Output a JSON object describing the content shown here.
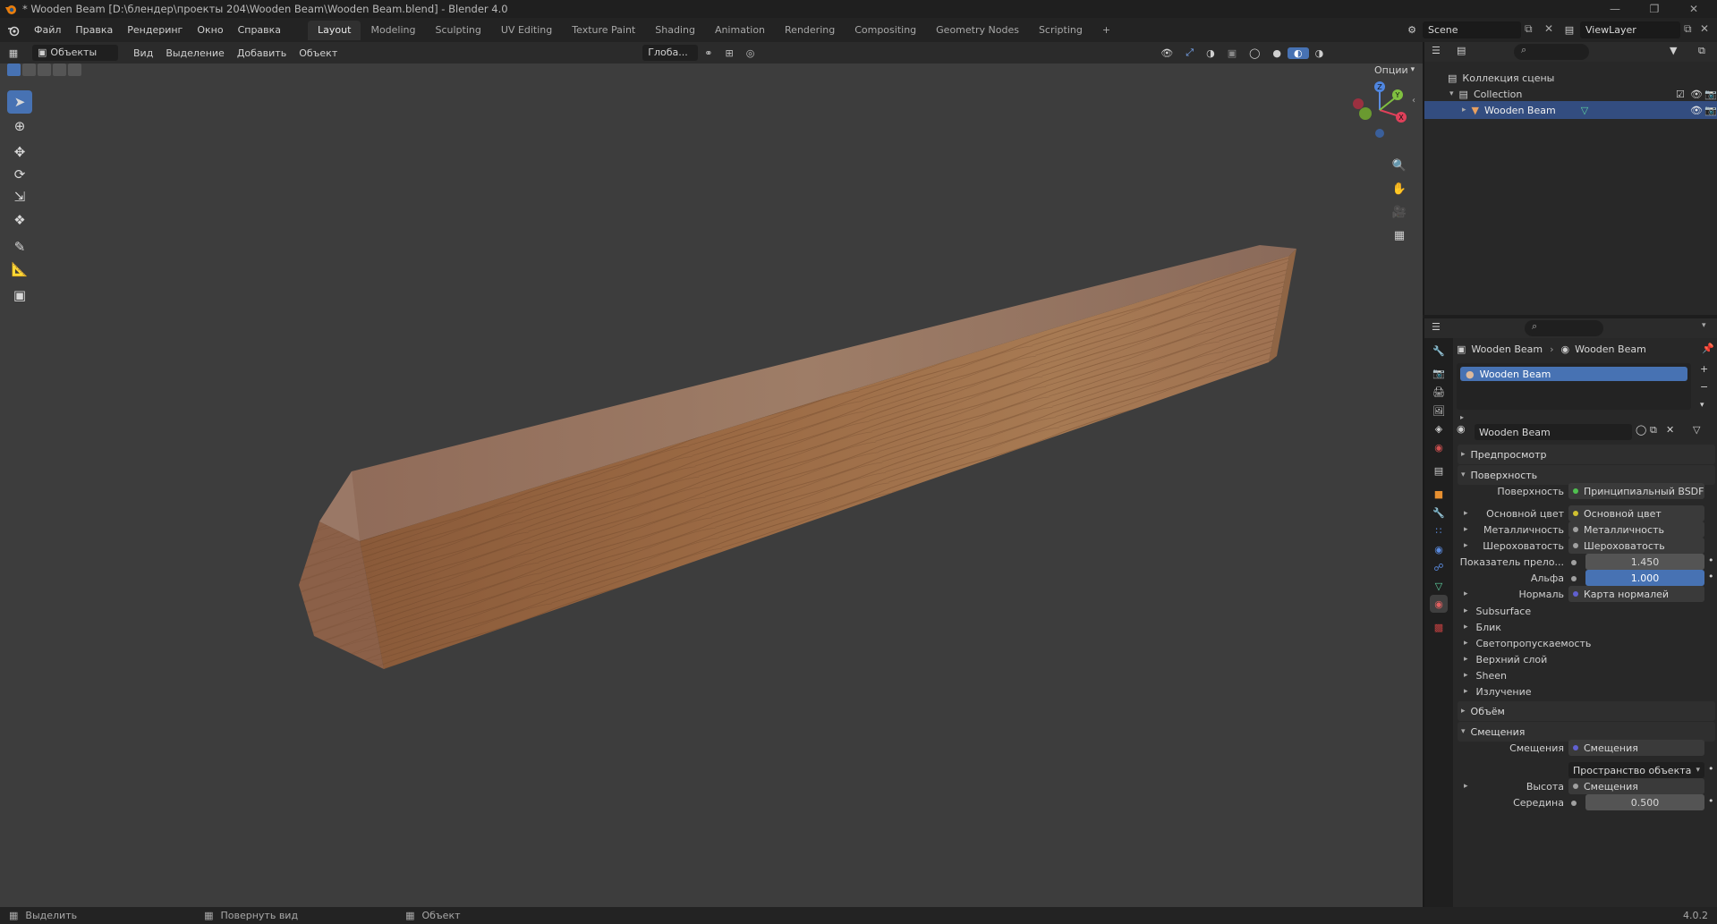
{
  "window": {
    "title": "* Wooden Beam [D:\\блендер\\проекты 204\\Wooden Beam\\Wooden Beam.blend] - Blender 4.0"
  },
  "menu": [
    "Файл",
    "Правка",
    "Рендеринг",
    "Окно",
    "Справка"
  ],
  "workspaces": [
    "Layout",
    "Modeling",
    "Sculpting",
    "UV Editing",
    "Texture Paint",
    "Shading",
    "Animation",
    "Rendering",
    "Compositing",
    "Geometry Nodes",
    "Scripting"
  ],
  "workspace_add": "+",
  "scene": {
    "name": "Scene",
    "view_layer": "ViewLayer"
  },
  "viewport_header": {
    "mode": "Объекты",
    "menus": [
      "Вид",
      "Выделение",
      "Добавить",
      "Объект"
    ],
    "orientation": "Глоба...",
    "options": "Опции"
  },
  "gizmo": {
    "x": "X",
    "y": "Y",
    "z": "Z"
  },
  "outliner": {
    "scene_collection": "Коллекция сцены",
    "collection": "Collection",
    "object": "Wooden Beam"
  },
  "properties": {
    "breadcrumb_object": "Wooden Beam",
    "breadcrumb_material": "Wooden Beam",
    "slot_material": "Wooden Beam",
    "material_name": "Wooden Beam",
    "sections": {
      "preview": "Предпросмотр",
      "surface": "Поверхность",
      "volume": "Объём",
      "displacement": "Смещения"
    },
    "surface_rows": [
      {
        "label": "Поверхность",
        "value": "Принципиальный BSDF"
      },
      {
        "label": "Основной цвет",
        "value": "Основной цвет"
      },
      {
        "label": "Металличность",
        "value": "Металличность"
      },
      {
        "label": "Шероховатость",
        "value": "Шероховатость"
      },
      {
        "label": "Показатель прело...",
        "value": "1.450"
      },
      {
        "label": "Альфа",
        "value": "1.000"
      },
      {
        "label": "Нормаль",
        "value": "Карта нормалей"
      }
    ],
    "subpanels": [
      "Subsurface",
      "Блик",
      "Светопропускаемость",
      "Верхний слой",
      "Sheen",
      "Излучение"
    ],
    "displacement_rows": [
      {
        "label": "Смещения",
        "value": "Смещения"
      },
      {
        "label": "",
        "value": "Пространство объекта"
      },
      {
        "label": "Высота",
        "value": "Смещения"
      },
      {
        "label": "Середина",
        "value": "0.500"
      }
    ]
  },
  "statusbar": {
    "select": "Выделить",
    "rotate": "Повернуть вид",
    "object": "Объект",
    "version": "4.0.2"
  }
}
